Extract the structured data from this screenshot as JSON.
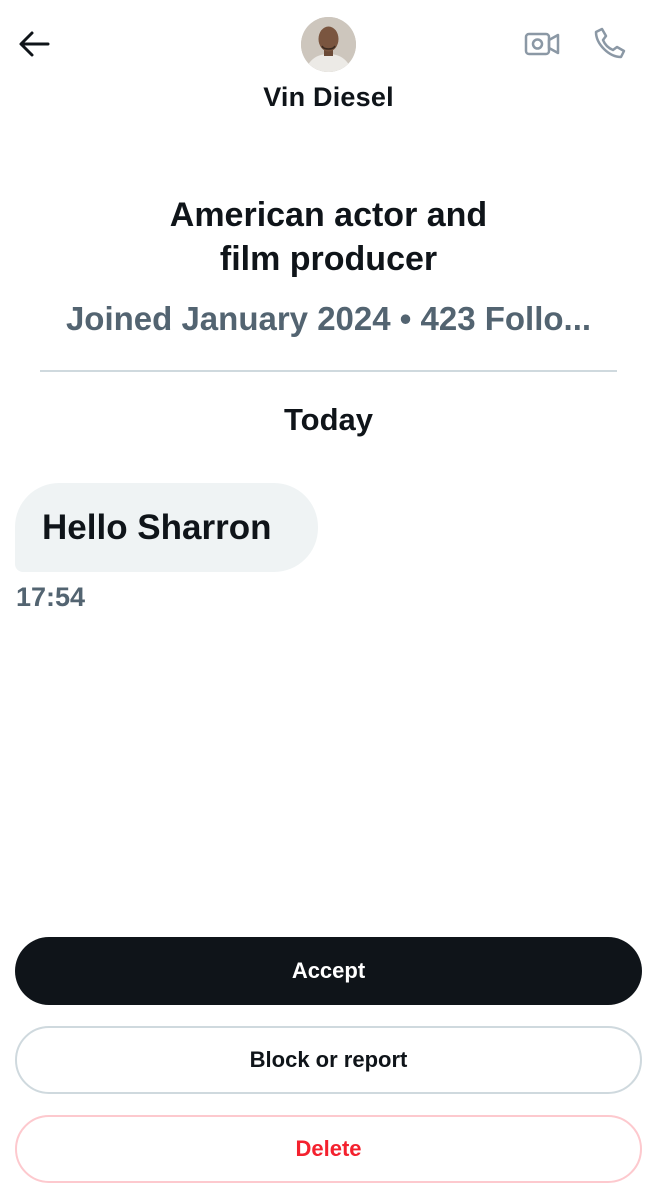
{
  "header": {
    "name": "Vin Diesel",
    "back_icon": "arrow-left-icon",
    "video_icon": "video-camera-icon",
    "phone_icon": "phone-icon"
  },
  "profile": {
    "bio_line1": "American actor and",
    "bio_line2": "film producer",
    "meta": "Joined January 2024 • 423 Follo..."
  },
  "conversation": {
    "day_label": "Today",
    "messages": [
      {
        "text": "Hello Sharron",
        "time": "17:54"
      }
    ]
  },
  "actions": {
    "accept_label": "Accept",
    "block_label": "Block or report",
    "delete_label": "Delete"
  },
  "colors": {
    "text": "#0f1419",
    "secondary": "#536471",
    "bubble": "#eff3f4",
    "divider": "#cfd9de",
    "danger": "#f4212e"
  }
}
